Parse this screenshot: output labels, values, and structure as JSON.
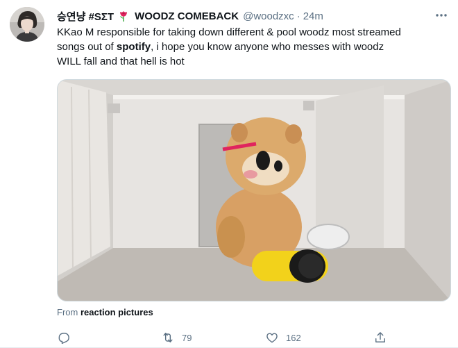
{
  "author": {
    "display_name": "승연냥 #SΣT",
    "display_name_2": "WOODZ COMEBACK",
    "handle": "@woodzxc",
    "separator": "·",
    "time": "24m",
    "avatar_icon": "avatar-photo"
  },
  "tweet": {
    "lines": [
      {
        "before": "KKao M responsible for taking down different & pool woodz most streamed",
        "bold": "",
        "after": ""
      },
      {
        "before": "songs out of ",
        "bold": "spotify",
        "after": ", i hope you know anyone who messes with woodz"
      },
      {
        "before": "WILL fall and that hell is hot",
        "bold": "",
        "after": ""
      }
    ]
  },
  "media": {
    "description_icon": "video-thumbnail"
  },
  "source": {
    "prefix": "From ",
    "name": "reaction pictures"
  },
  "actions": {
    "reply": {
      "icon": "reply-icon",
      "count": ""
    },
    "retweet": {
      "icon": "retweet-icon",
      "count": "79"
    },
    "like": {
      "icon": "heart-icon",
      "count": "162"
    },
    "share": {
      "icon": "share-icon",
      "count": ""
    }
  },
  "colors": {
    "text": "#0f1419",
    "secondary": "#5b7083",
    "rose": "#e0245e",
    "leaf": "#4caf50"
  }
}
